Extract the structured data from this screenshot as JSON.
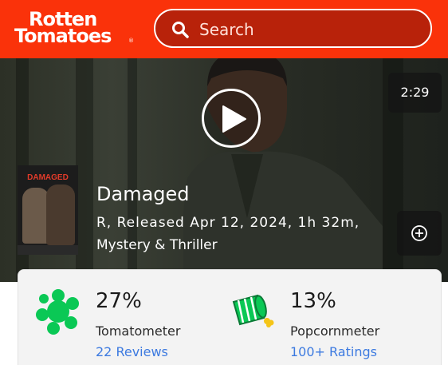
{
  "header": {
    "logo_line1": "Rotten",
    "logo_line2": "Tomatoes",
    "logo_mark": "®",
    "search_placeholder": "Search",
    "search_icon": "search-icon",
    "colors": {
      "brand": "#fa320a"
    }
  },
  "hero": {
    "duration": "2:29",
    "play_icon": "play-icon",
    "poster_title": "DAMAGED",
    "title": "Damaged",
    "meta": "R, Released Apr 12, 2024, 1h 32m,",
    "genre": "Mystery & Thriller",
    "add_icon": "plus-circle-icon"
  },
  "scores": {
    "tomatometer": {
      "value": "27%",
      "label": "Tomatometer",
      "link": "22 Reviews",
      "icon": "rotten-splat-icon",
      "color": "#0ac855"
    },
    "popcornmeter": {
      "value": "13%",
      "label": "Popcornmeter",
      "link": "100+ Ratings",
      "icon": "spilled-popcorn-icon",
      "color": "#0ac855"
    }
  }
}
